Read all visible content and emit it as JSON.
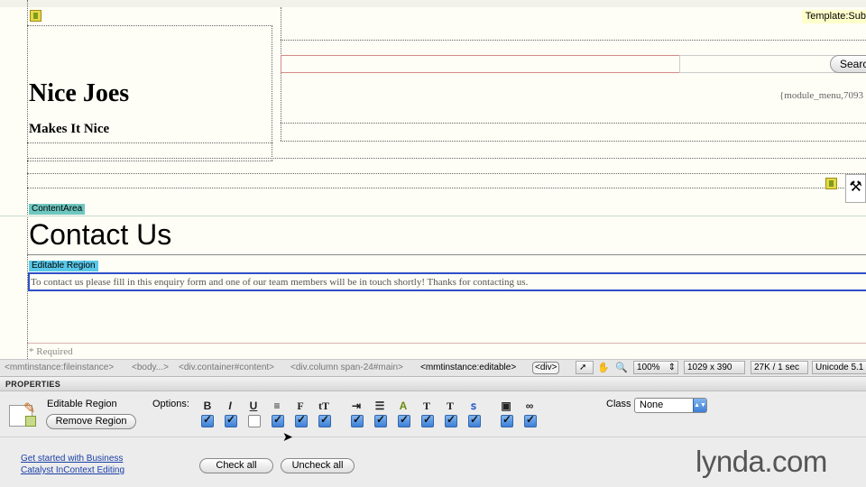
{
  "document": {
    "template_tag": "Template:Sub",
    "logo_title": "Nice Joes",
    "logo_subtitle": "Makes It Nice",
    "search_button": "Searc",
    "module_menu": "{module_menu,7093",
    "content_area_label": "ContentArea",
    "heading": "Contact Us",
    "editable_region_label": "Editable Region",
    "paragraph": "To contact us please fill in this enquiry form and one of our team members will be in touch shortly! Thanks for contacting us.",
    "required_note": "* Required"
  },
  "statusbar": {
    "breadcrumbs": [
      "<mmtinstance:fileinstance>",
      "<body...>",
      "<div.container#content>",
      "<div.column span-24#main>",
      "<mmtinstance:editable>",
      "<div>"
    ],
    "zoom": "100%",
    "window_size": "1029 x 390",
    "file_size": "27K / 1 sec",
    "encoding": "Unicode 5.1"
  },
  "properties": {
    "panel_title": "PROPERTIES",
    "region_name": "Editable Region",
    "remove_region": "Remove Region",
    "options_label": "Options:",
    "class_label": "Class",
    "class_value": "None",
    "check_all": "Check all",
    "uncheck_all": "Uncheck all",
    "link_line1": "Get started with Business",
    "link_line2": "Catalyst InContext Editing",
    "option_icons": [
      "bold-icon",
      "italic-icon",
      "underline-icon",
      "align-center-icon",
      "font-icon",
      "font-size-icon",
      "indent-icon",
      "numbered-list-icon",
      "text-color-icon",
      "text-style-icon",
      "text-background-icon",
      "hyperlink-icon",
      "image-icon",
      "link-icon"
    ],
    "option_glyphs": [
      "B",
      "I",
      "U",
      "≡",
      "F",
      "tT",
      "⇥",
      "☰",
      "A",
      "T",
      "T",
      "ꜱ",
      "▣",
      "∞"
    ],
    "option_checked": [
      true,
      true,
      false,
      true,
      true,
      true,
      true,
      true,
      true,
      true,
      true,
      true,
      true,
      true
    ]
  },
  "branding": {
    "watermark": "lynda.com"
  }
}
